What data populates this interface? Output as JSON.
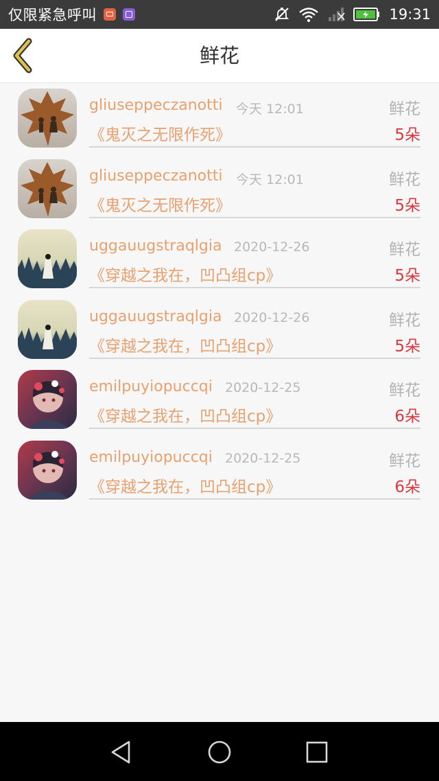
{
  "status_bar": {
    "carrier": "仅限紧急呼叫",
    "time": "19:31",
    "icons": [
      "mail-icon",
      "gallery-icon",
      "mute-icon",
      "wifi-icon",
      "signal-icon",
      "battery-icon"
    ]
  },
  "header": {
    "title": "鲜花",
    "back_icon": "chevron-left-icon"
  },
  "list": {
    "items": [
      {
        "username": "gliuseppeczanotti",
        "date": "今天 12:01",
        "gift": "鲜花",
        "book": "《鬼灭之无限作死》",
        "count": "5朵",
        "avatar": "silhouette-leaf"
      },
      {
        "username": "gliuseppeczanotti",
        "date": "今天 12:01",
        "gift": "鲜花",
        "book": "《鬼灭之无限作死》",
        "count": "5朵",
        "avatar": "silhouette-leaf"
      },
      {
        "username": "uggauugstraqlgia",
        "date": "2020-12-26",
        "gift": "鲜花",
        "book": "《穿越之我在，凹凸组cp》",
        "count": "5朵",
        "avatar": "girl-grass"
      },
      {
        "username": "uggauugstraqlgia",
        "date": "2020-12-26",
        "gift": "鲜花",
        "book": "《穿越之我在，凹凸组cp》",
        "count": "5朵",
        "avatar": "girl-grass"
      },
      {
        "username": "emilpuyiopuccqi",
        "date": "2020-12-25",
        "gift": "鲜花",
        "book": "《穿越之我在，凹凸组cp》",
        "count": "6朵",
        "avatar": "anime-flowers"
      },
      {
        "username": "emilpuyiopuccqi",
        "date": "2020-12-25",
        "gift": "鲜花",
        "book": "《穿越之我在，凹凸组cp》",
        "count": "6朵",
        "avatar": "anime-flowers"
      }
    ]
  },
  "nav_bar": {
    "back": "triangle-back-icon",
    "home": "circle-home-icon",
    "recents": "square-recents-icon"
  },
  "colors": {
    "accent": "#e8a06e",
    "count": "#d8383f",
    "muted": "#b3b3b3",
    "back_icon": "#e0c24a"
  }
}
